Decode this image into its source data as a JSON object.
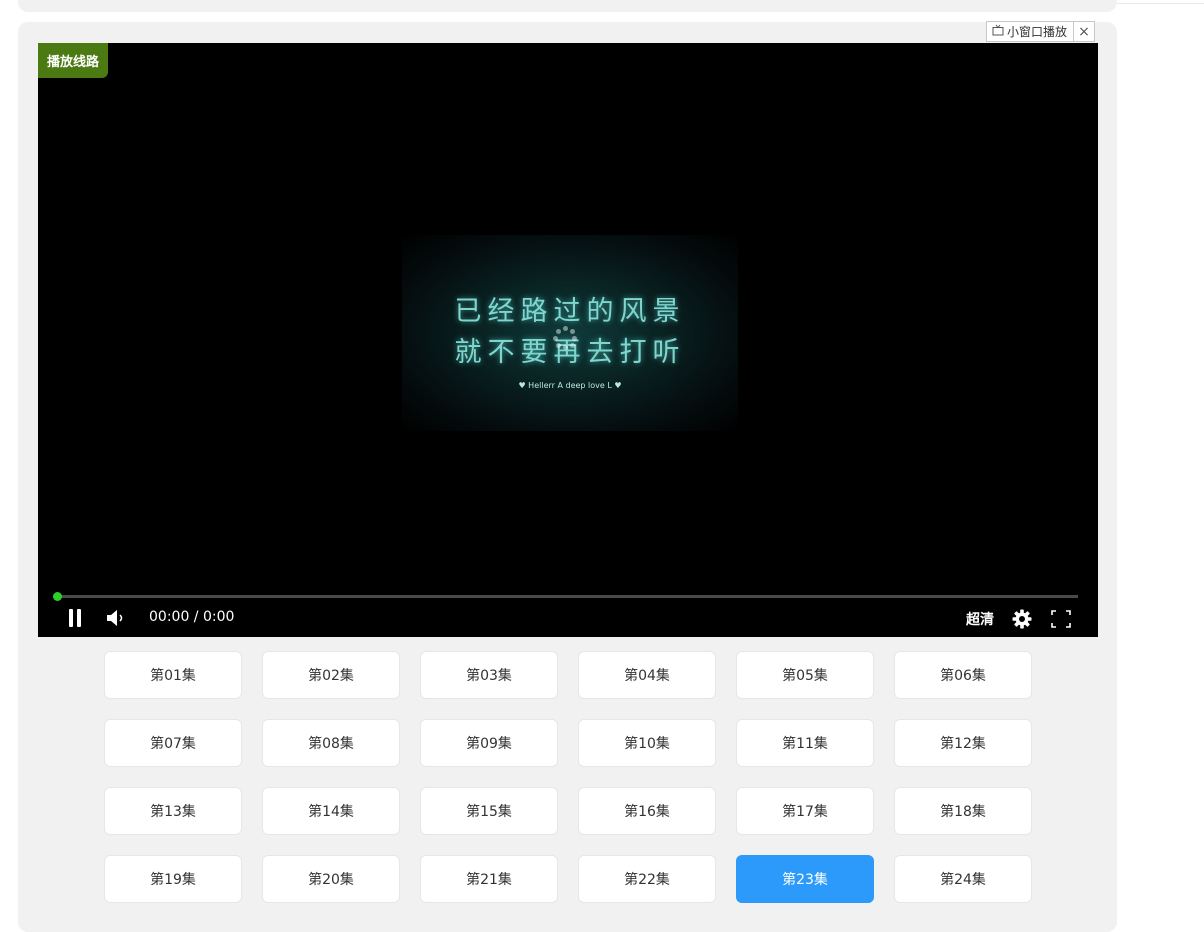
{
  "mini_player": {
    "label": "小窗口播放",
    "close": "×"
  },
  "player": {
    "route_badge": "播放线路",
    "poster": {
      "line1": "已经路过的风景",
      "line2": "就不要再去打听",
      "subtitle": "♥ Hellerr A deep love L ♥"
    },
    "time": "00:00 / 0:00",
    "progress": 0,
    "quality": "超清",
    "accent_color": "#2ad12a"
  },
  "episodes": {
    "active_index": 22,
    "active_color": "#2b9afa",
    "items": [
      "第01集",
      "第02集",
      "第03集",
      "第04集",
      "第05集",
      "第06集",
      "第07集",
      "第08集",
      "第09集",
      "第10集",
      "第11集",
      "第12集",
      "第13集",
      "第14集",
      "第15集",
      "第16集",
      "第17集",
      "第18集",
      "第19集",
      "第20集",
      "第21集",
      "第22集",
      "第23集",
      "第24集"
    ]
  }
}
